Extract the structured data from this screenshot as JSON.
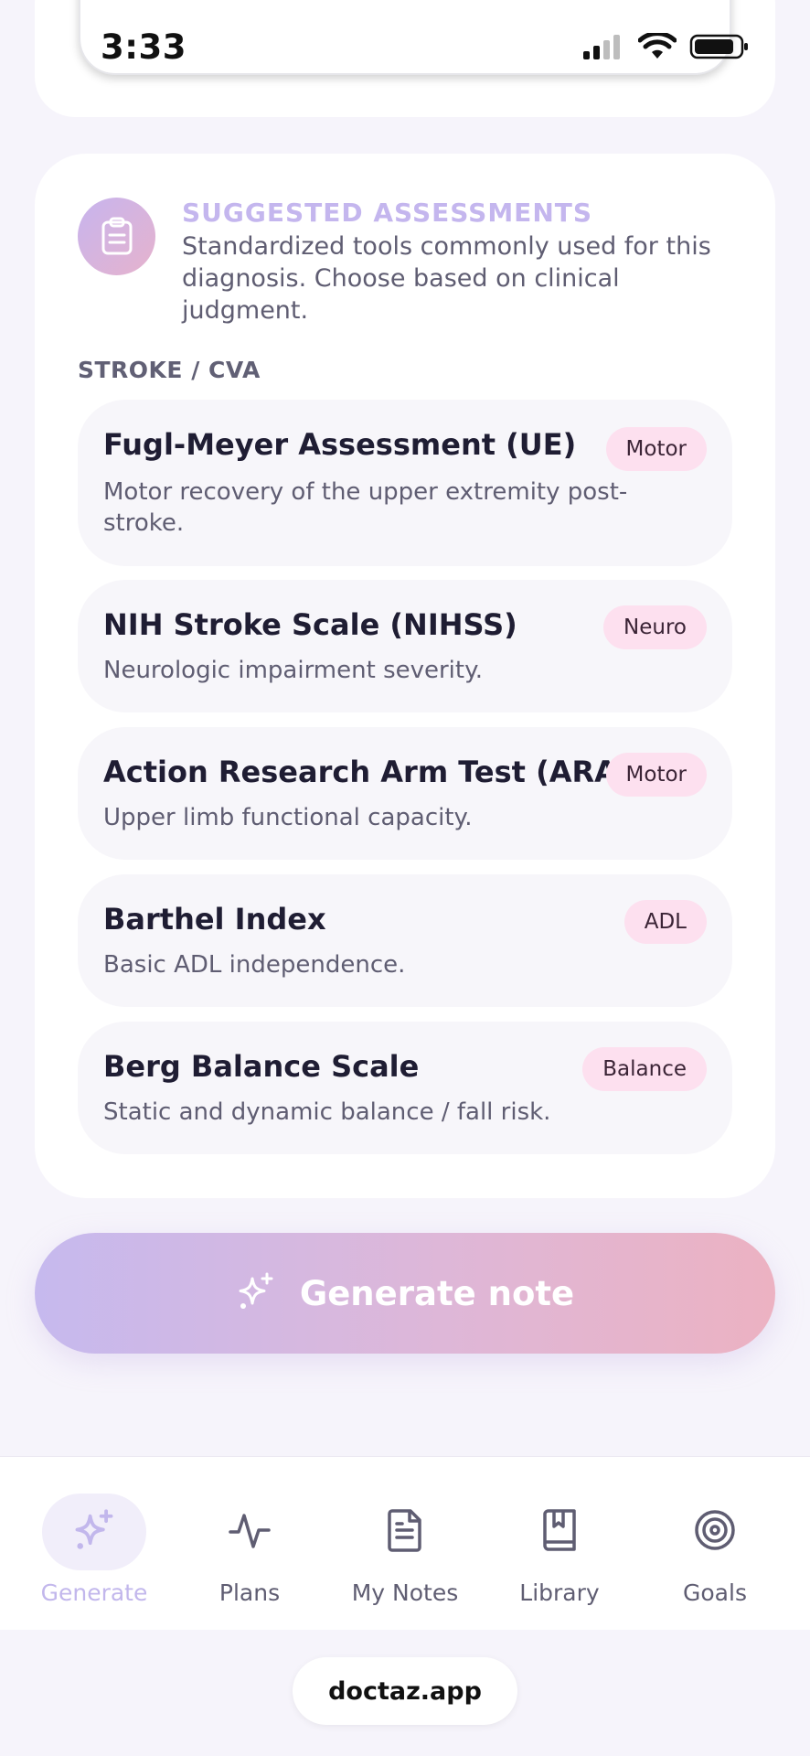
{
  "status_bar": {
    "time": "3:33"
  },
  "suggestions": {
    "title": "SUGGESTED ASSESSMENTS",
    "description": "Standardized tools commonly used for this diagnosis. Choose based on clinical judgment.",
    "section_label": "STROKE / CVA",
    "items": [
      {
        "title": "Fugl-Meyer Assessment (UE)",
        "badge": "Motor",
        "description": "Motor recovery of the upper extremity post-stroke."
      },
      {
        "title": "NIH Stroke Scale (NIHSS)",
        "badge": "Neuro",
        "description": "Neurologic impairment severity."
      },
      {
        "title": "Action Research Arm Test (ARAT)",
        "badge": "Motor",
        "description": "Upper limb functional capacity."
      },
      {
        "title": "Barthel Index",
        "badge": "ADL",
        "description": "Basic ADL independence."
      },
      {
        "title": "Berg Balance Scale",
        "badge": "Balance",
        "description": "Static and dynamic balance / fall risk."
      }
    ]
  },
  "generate_button": {
    "label": "Generate note",
    "icon": "sparkle-icon"
  },
  "nav": {
    "items": [
      {
        "label": "Generate",
        "icon": "sparkle-icon",
        "active": true
      },
      {
        "label": "Plans",
        "icon": "pulse-icon"
      },
      {
        "label": "My Notes",
        "icon": "document-icon"
      },
      {
        "label": "Library",
        "icon": "book-icon"
      },
      {
        "label": "Goals",
        "icon": "target-icon"
      }
    ]
  },
  "footer": {
    "url": "doctaz.app"
  },
  "colors": {
    "accent_lavender": "#c4b6ee",
    "accent_pink": "#ecb2c2",
    "badge_bg": "#fde0ef"
  }
}
